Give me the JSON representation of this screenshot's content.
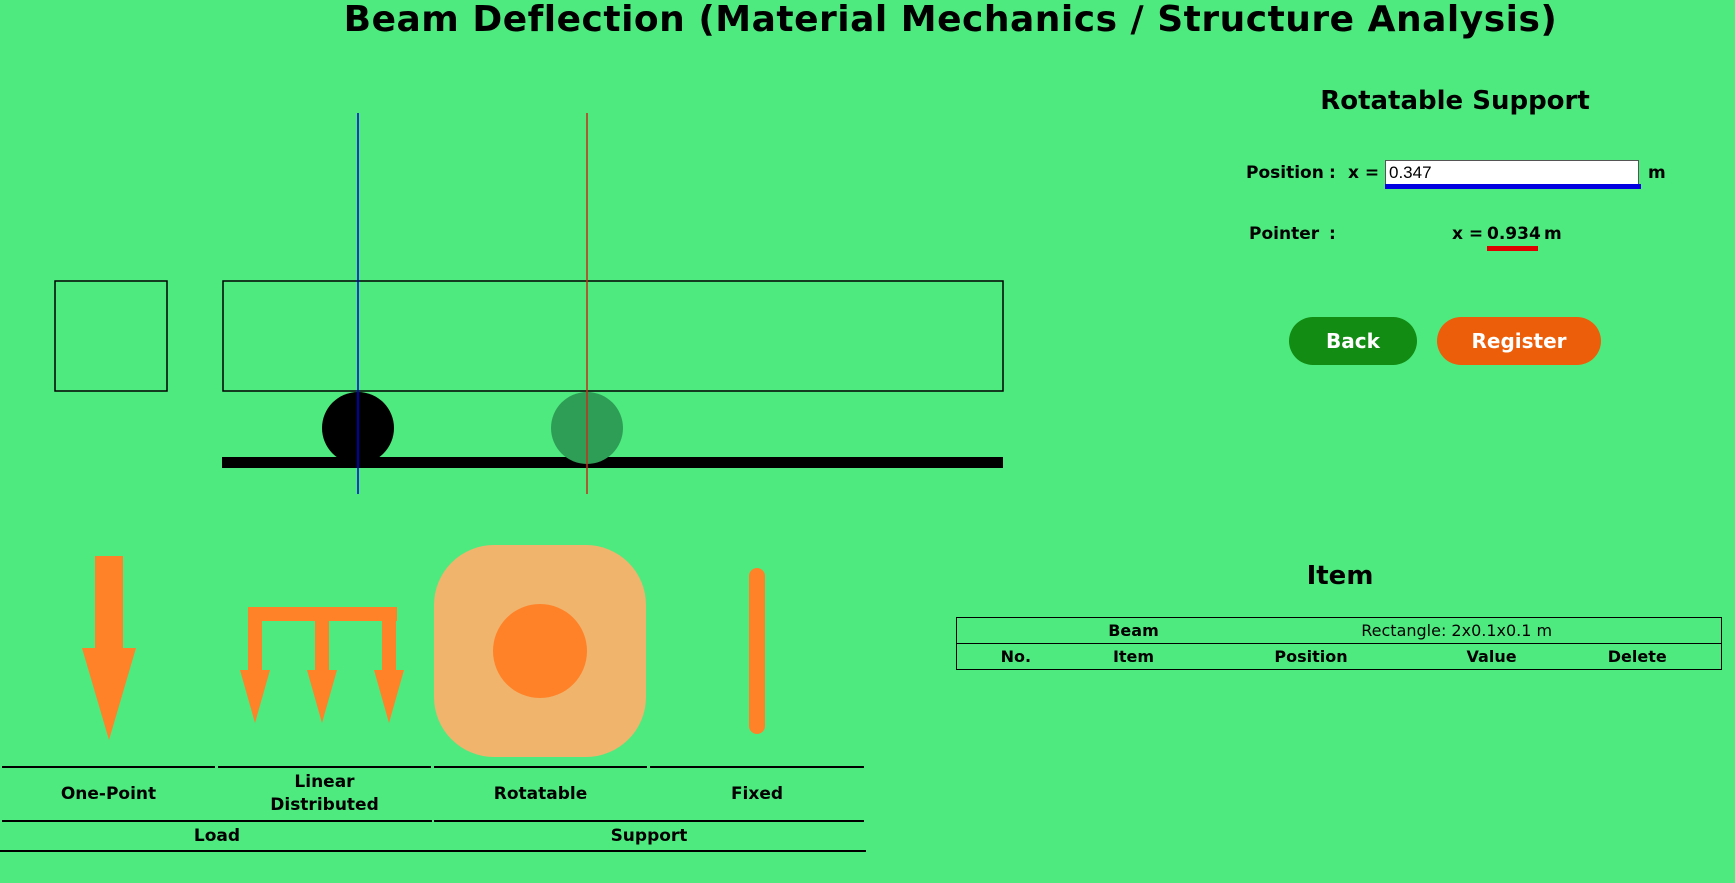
{
  "title": "Beam Deflection (Material Mechanics / Structure Analysis)",
  "panel": {
    "heading": "Rotatable Support",
    "position_label": "Position",
    "colon": ":",
    "x_eq": "x =",
    "position_value": "0.347",
    "unit": "m",
    "pointer_label": "Pointer",
    "pointer_value": "0.934",
    "back_label": "Back",
    "register_label": "Register"
  },
  "colors": {
    "background": "#4eea7f",
    "accent_orange": "#ff8228",
    "tile_orange": "#f0b46c",
    "position_line": "#0000e0",
    "pointer_line": "#c03018",
    "back": "#128c12",
    "register": "#ec5e0a"
  },
  "palette": {
    "items": [
      {
        "label": "One-Point",
        "icon": "arrow-down-icon"
      },
      {
        "label": "Linear\nDistributed",
        "icon": "distributed-load-icon"
      },
      {
        "label": "Rotatable",
        "icon": "circle-support-icon"
      },
      {
        "label": "Fixed",
        "icon": "bar-support-icon"
      }
    ],
    "groups": [
      {
        "label": "Load"
      },
      {
        "label": "Support"
      }
    ]
  },
  "items": {
    "heading": "Item",
    "beam_label": "Beam",
    "beam_value": "Rectangle: 2x0.1x0.1 m",
    "columns": [
      "No.",
      "Item",
      "Position",
      "Value",
      "Delete"
    ]
  }
}
